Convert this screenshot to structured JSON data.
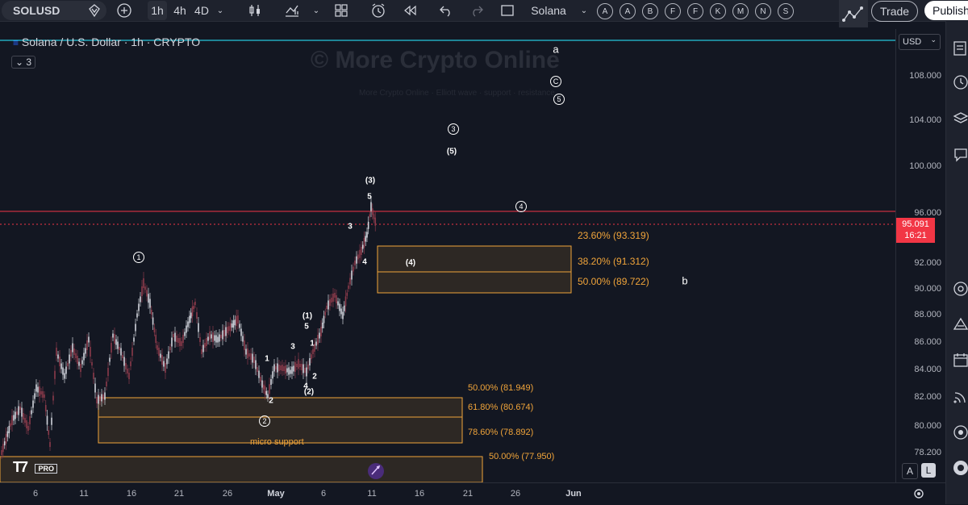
{
  "toolbar": {
    "symbol": "SOLUSD",
    "intervals": [
      "1h",
      "4h",
      "4D"
    ],
    "exchange": "Solana",
    "letters": [
      "A",
      "A",
      "B",
      "F",
      "F",
      "K",
      "M",
      "N",
      "S"
    ],
    "trade": "Trade",
    "publish": "Publish"
  },
  "chart": {
    "title": "Solana / U.S. Dollar · 1h · CRYPTO",
    "indicator_count": "3",
    "watermark": "© More Crypto Online",
    "watermark_sub": "More Crypto Online · Elliott wave · support · resistance",
    "currency": "USD",
    "last_price": "95.091",
    "countdown": "16:21",
    "scale_mode_a": "A",
    "scale_mode_l": "L",
    "brand": "PRO"
  },
  "price_ticks": [
    "108.000",
    "104.000",
    "100.000",
    "96.000",
    "92.000",
    "90.000",
    "88.000",
    "86.000",
    "84.000",
    "82.000",
    "80.000",
    "78.200"
  ],
  "date_ticks": [
    "6",
    "11",
    "16",
    "21",
    "26",
    "May",
    "6",
    "11",
    "16",
    "21",
    "26",
    "Jun"
  ],
  "fib_levels": [
    {
      "label": "23.60% (93.319)"
    },
    {
      "label": "38.20% (91.312)"
    },
    {
      "label": "50.00% (89.722)"
    },
    {
      "label": "50.00% (81.949)"
    },
    {
      "label": "61.80% (80.674)"
    },
    {
      "label": "78.60% (78.892)"
    },
    {
      "label": "50.00% (77.950)"
    }
  ],
  "zone_labels": {
    "micro_support": "micro support"
  },
  "waves": {
    "circled": [
      "1",
      "2",
      "3",
      "4",
      "5",
      "C"
    ],
    "paren": [
      "(1)",
      "(2)",
      "(3)",
      "(4)",
      "(5)"
    ],
    "plain": [
      "1",
      "2",
      "3",
      "4",
      "5",
      "a",
      "b"
    ]
  },
  "colors": {
    "bg": "#131722",
    "fib": "#f0a43a",
    "resistance": "#f23645",
    "cyan": "#26c6da",
    "candle_up": "#d1d4dc",
    "candle_down": "#8b3a4a"
  }
}
